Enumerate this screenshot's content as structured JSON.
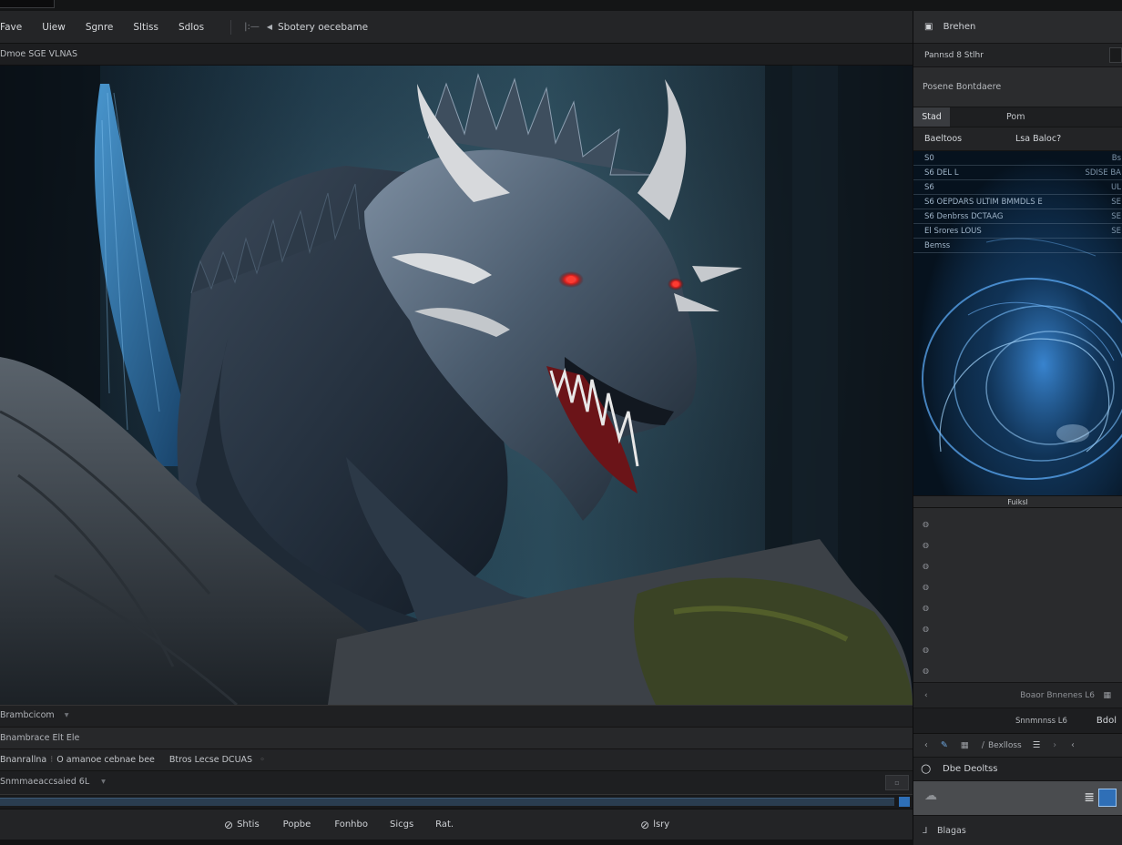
{
  "menubar": {
    "items": [
      "Fave",
      "Uiew",
      "Sgnre",
      "Sltiss",
      "Sdlos"
    ],
    "title": "Sbotery oecebame"
  },
  "path": {
    "text": "Dmoe SGE VLNAS"
  },
  "layers": {
    "label": "Brambcicom"
  },
  "row2": {
    "label": "Bnambrace Elt Ele"
  },
  "row3": {
    "col1": "Bnanrallna",
    "col2": "O amanoe cebnae bee",
    "col3": "Btros Lecse DCUAS"
  },
  "row4": {
    "label": "Snmmaeaccsaied 6L"
  },
  "progress": {
    "fraction": 0.98
  },
  "actionbar": {
    "items": [
      "Shtis",
      "Popbe",
      "Fonhbo",
      "Sicgs",
      "Rat."
    ],
    "right": "lsry"
  },
  "sidebar": {
    "header": "Brehen",
    "field": "Pannsd 8 Stlhr",
    "section": "Posene Bontdaere",
    "tab_active": "Stad",
    "tab_other": "Pom",
    "col_a": "Baeltoos",
    "col_b": "Lsa Baloc?",
    "preview_rows": [
      {
        "code": "S0",
        "name": "",
        "value": "Bs"
      },
      {
        "code": "S6",
        "name": "DEL L",
        "value": "SDISE BA"
      },
      {
        "code": "S6",
        "name": "",
        "value": "UL"
      },
      {
        "code": "S6",
        "name": "OEPDARS ULTIM BMMDLS E",
        "value": "SE"
      },
      {
        "code": "S6",
        "name": "Denbrss DCTAAG",
        "value": "SE"
      },
      {
        "code": "El",
        "name": "Srores LOUS",
        "value": "SE"
      },
      {
        "code": "",
        "name": "Bemss",
        "value": ""
      }
    ],
    "preview_label": "Fuiksl",
    "status": "Boaor Bnnenes L6",
    "panel_label": "Snnmnnss L6",
    "panel_value": "Bdol",
    "tool_label": "Bexlloss",
    "search_label": "Dbe Deoltss",
    "bottom_label": "Blagas"
  },
  "colors": {
    "accent": "#2e6fb7",
    "panel": "#27282a",
    "toolbar": "#242527"
  }
}
